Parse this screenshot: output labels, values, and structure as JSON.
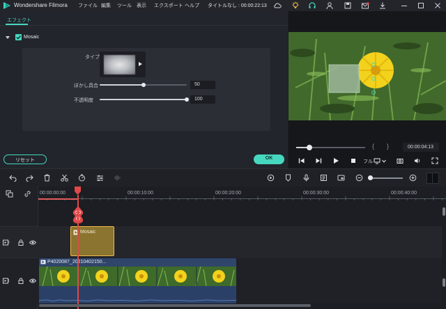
{
  "app": {
    "title": "Wondershare Filmora",
    "project_title": "タイトルなし : 00:00:22:13"
  },
  "menu": [
    "ファイル",
    "編集",
    "ツール",
    "表示",
    "エクスポート",
    "ヘルプ"
  ],
  "titlebar_icons": [
    "cloud-icon",
    "bulb-icon",
    "headset-icon",
    "account-icon",
    "save-icon",
    "mail-icon",
    "download-icon",
    "minimize-icon",
    "maximize-icon",
    "close-icon"
  ],
  "effect_panel": {
    "tab": "エフェクト",
    "effect_name": "Mosaic",
    "effect_enabled": true,
    "type_label": "タイプ",
    "blur_label": "ぼかし具合",
    "blur_value": "50",
    "blur_level": 0.5,
    "opacity_label": "不透明度",
    "opacity_value": "100",
    "opacity_level": 1.0,
    "reset_label": "リセット",
    "ok_label": "OK"
  },
  "preview": {
    "time": "00:00:04:13",
    "brace_open": "{",
    "brace_close": "}",
    "quality_label": "フル",
    "progress": 0.19
  },
  "toolbar": {
    "left_icons": [
      "undo-icon",
      "redo-icon",
      "delete-icon",
      "cut-icon",
      "speed-icon",
      "adjust-icon",
      "audio-mixer-icon"
    ],
    "right_icons": [
      "render-icon",
      "marker-icon",
      "voiceover-icon",
      "mix-icon",
      "pip-icon",
      "zoom-out-icon",
      "zoom-in-icon"
    ],
    "zoom_level": 0.0
  },
  "timeline": {
    "ruler": [
      "00:00:00:00",
      "00:00:10:00",
      "00:00:20:00",
      "00:00:30:00",
      "00:00:40:00"
    ],
    "tracks": [
      {
        "number": "2",
        "clip": "Mosaic"
      },
      {
        "number": "1",
        "clip": "P4020087_20210402150..."
      }
    ]
  }
}
